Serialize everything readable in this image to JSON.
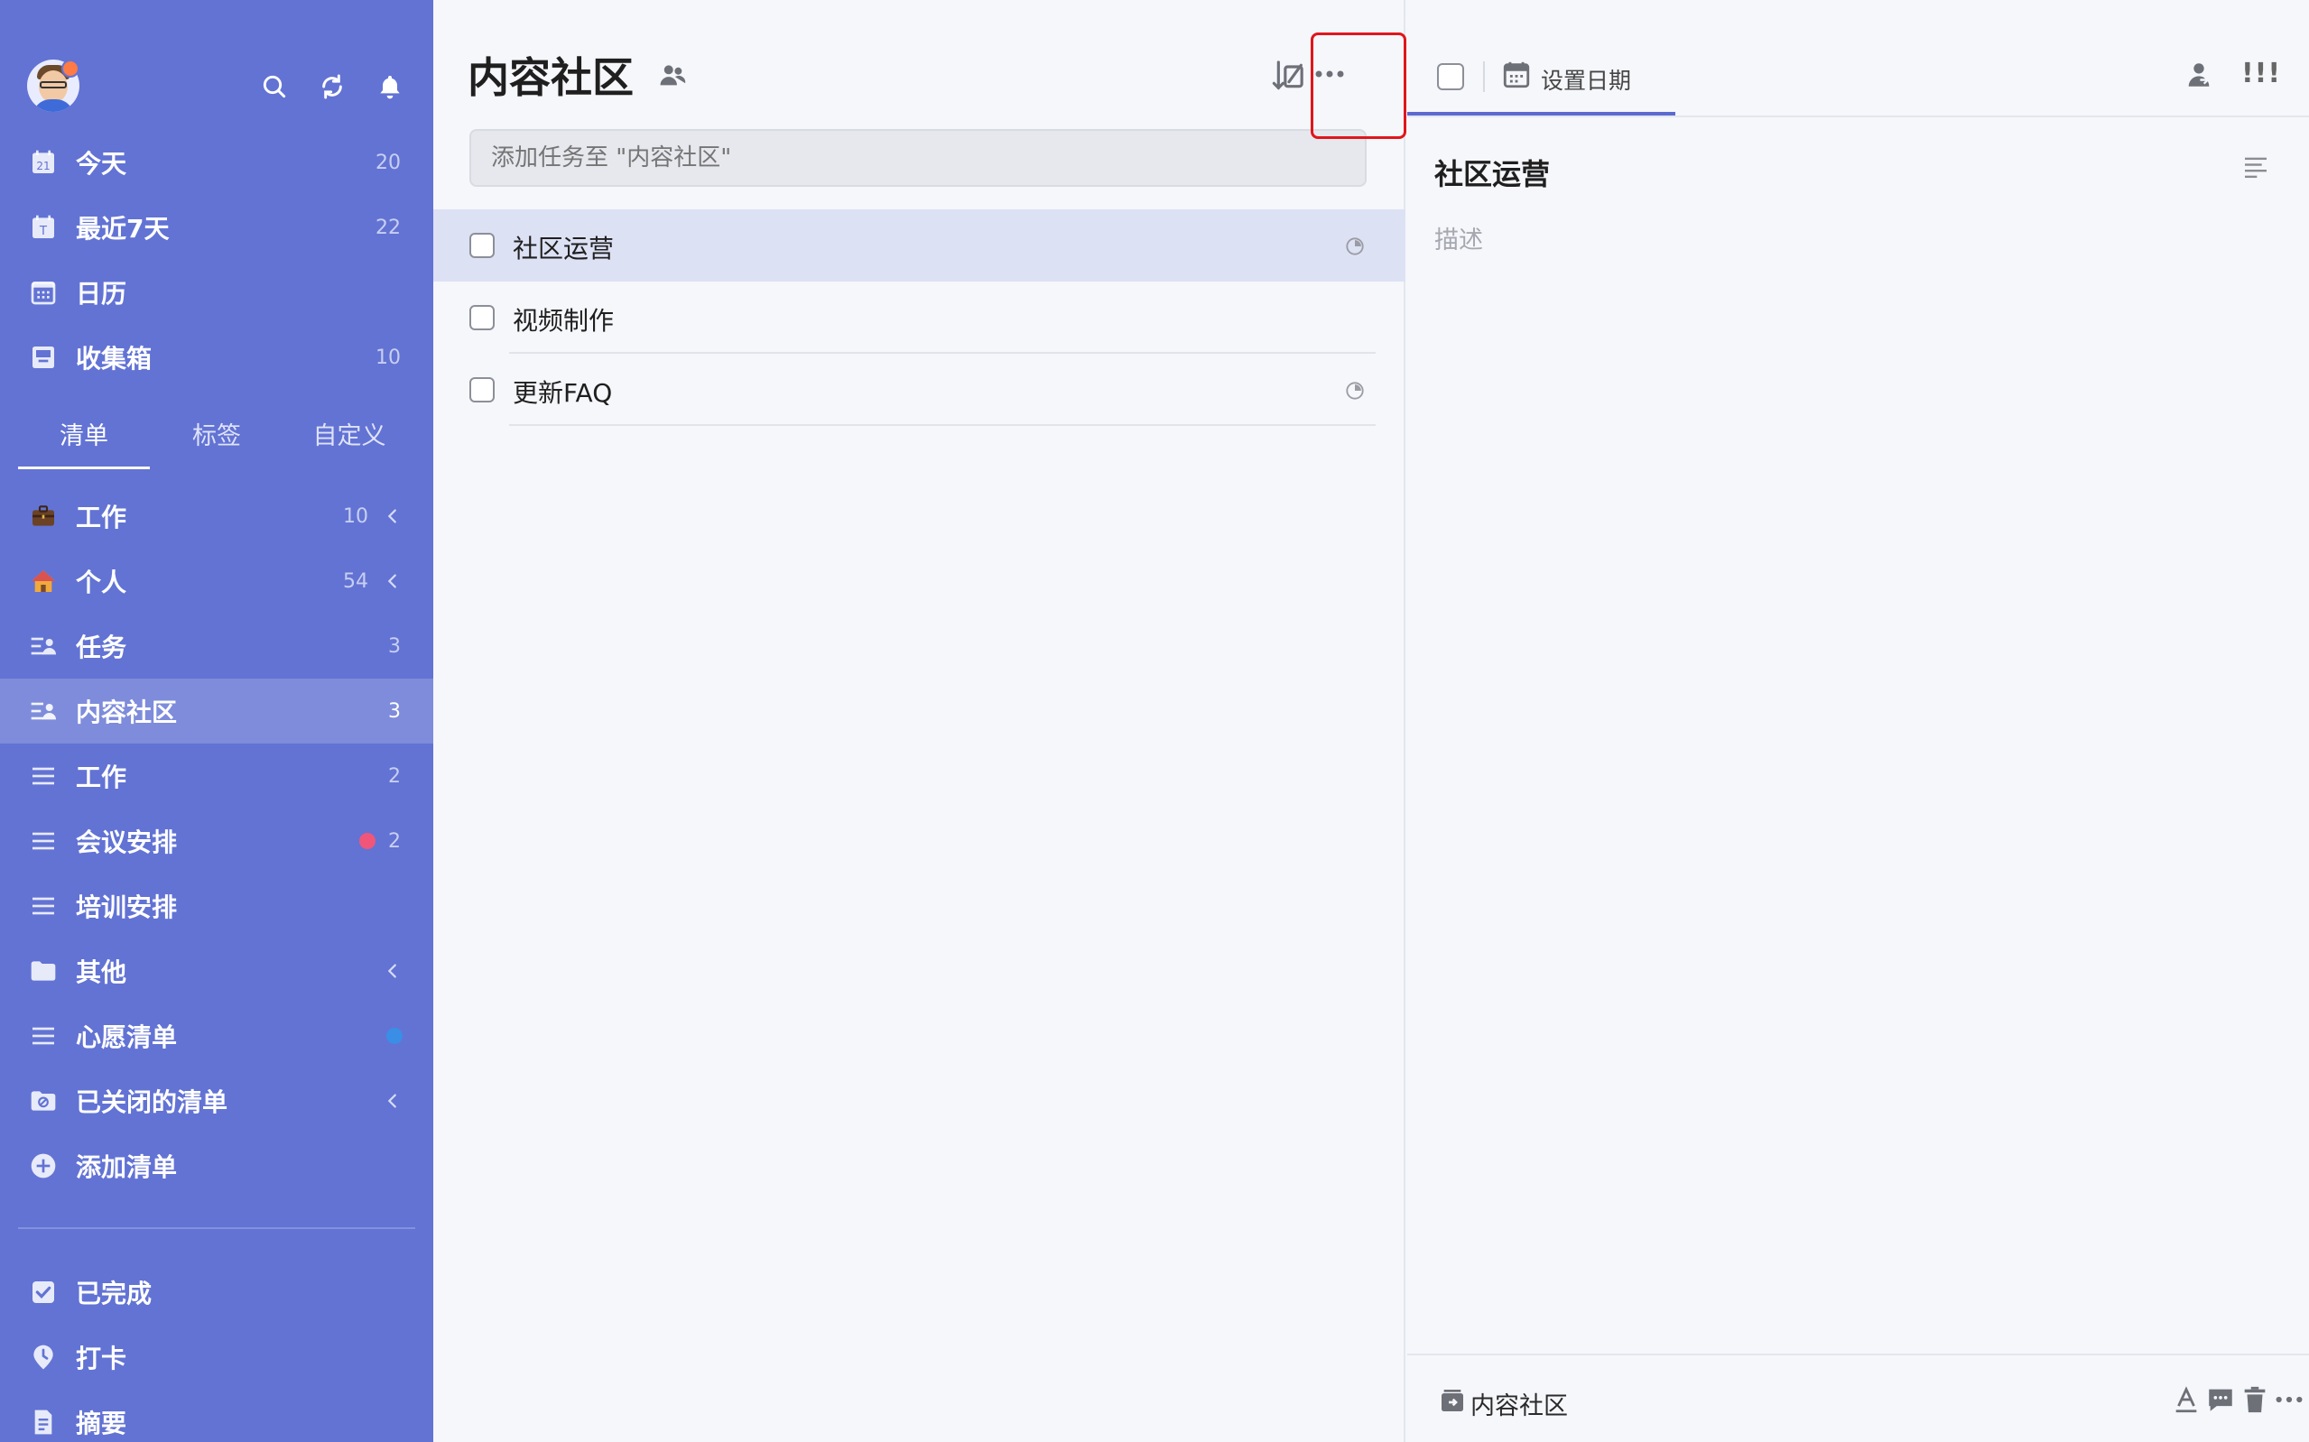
{
  "sidebar": {
    "top_icons": [
      "search-icon",
      "sync-icon",
      "bell-icon"
    ],
    "smart_lists": [
      {
        "label": "今天",
        "count": "20",
        "icon": "calendar-today-icon"
      },
      {
        "label": "最近7天",
        "count": "22",
        "icon": "calendar-week-icon"
      },
      {
        "label": "日历",
        "count": "",
        "icon": "calendar-grid-icon"
      },
      {
        "label": "收集箱",
        "count": "10",
        "icon": "inbox-icon"
      }
    ],
    "tabs": [
      "清单",
      "标签",
      "自定义"
    ],
    "active_tab": "清单",
    "lists": [
      {
        "label": "工作",
        "count": "10",
        "icon": "briefcase-icon",
        "expandable": true
      },
      {
        "label": "个人",
        "count": "54",
        "icon": "house-icon",
        "expandable": true
      },
      {
        "label": "任务",
        "count": "3",
        "icon": "shared-list-icon"
      },
      {
        "label": "内容社区",
        "count": "3",
        "icon": "shared-list-icon",
        "active": true
      },
      {
        "label": "工作",
        "count": "2",
        "icon": "list-icon"
      },
      {
        "label": "会议安排",
        "count": "2",
        "icon": "list-icon",
        "dot_color": "#f2557a"
      },
      {
        "label": "培训安排",
        "count": "",
        "icon": "list-icon"
      },
      {
        "label": "其他",
        "count": "",
        "icon": "folder-icon",
        "expandable": true
      },
      {
        "label": "心愿清单",
        "count": "",
        "icon": "list-icon",
        "dot_color": "#3a8ee6"
      },
      {
        "label": "已关闭的清单",
        "count": "",
        "icon": "closed-folder-icon",
        "expandable": true
      },
      {
        "label": "添加清单",
        "count": "",
        "icon": "plus-circle-icon"
      }
    ],
    "bottom": [
      {
        "label": "已完成",
        "icon": "checkbox-checked-icon"
      },
      {
        "label": "打卡",
        "icon": "pin-icon"
      },
      {
        "label": "摘要",
        "icon": "document-icon"
      }
    ]
  },
  "middle": {
    "title": "内容社区",
    "add_placeholder": "添加任务至 \"内容社区\"",
    "tasks": [
      {
        "label": "社区运营",
        "selected": true,
        "has_clock": true
      },
      {
        "label": "视频制作",
        "selected": false,
        "has_clock": false
      },
      {
        "label": "更新FAQ",
        "selected": false,
        "has_clock": true
      }
    ]
  },
  "detail": {
    "set_date_label": "设置日期",
    "priority_label": "!!!",
    "title": "社区运营",
    "description_placeholder": "描述",
    "footer_list": "内容社区"
  },
  "colors": {
    "sidebar_bg": "#6273d4",
    "accent": "#5b6ad0",
    "highlight_box": "#e0161b"
  }
}
